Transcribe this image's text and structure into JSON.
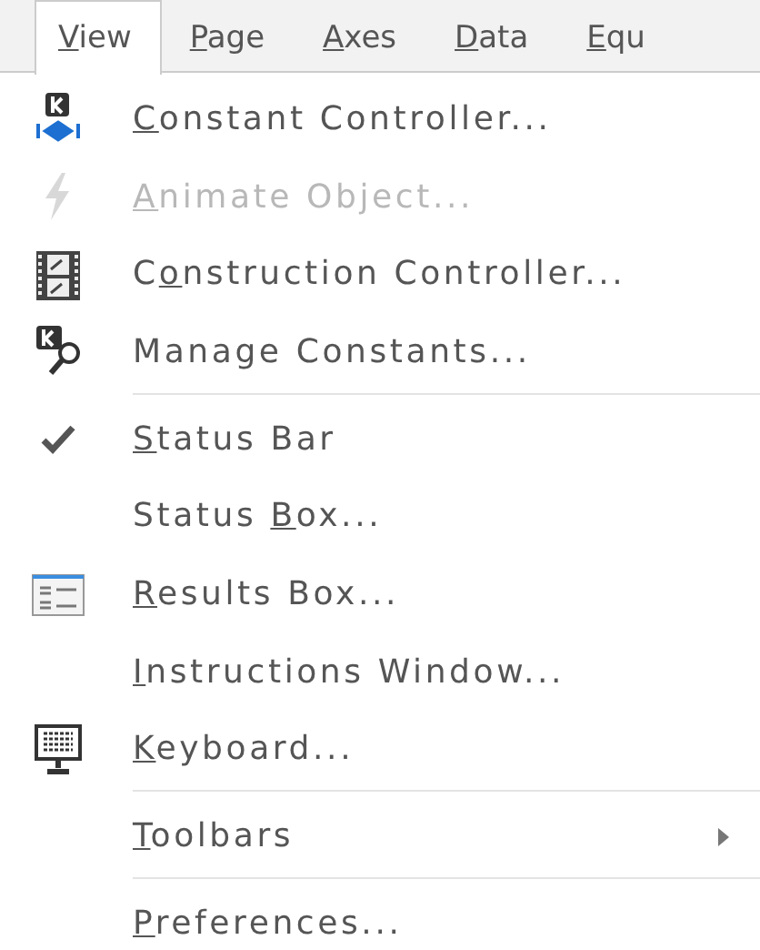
{
  "menu_bar": [
    {
      "key": "V",
      "post": "iew",
      "selected": true
    },
    {
      "key": "P",
      "post": "age",
      "selected": false
    },
    {
      "key": "A",
      "post": "xes",
      "selected": false
    },
    {
      "key": "D",
      "post": "ata",
      "selected": false
    },
    {
      "key": "E",
      "post": "qu",
      "selected": false
    }
  ],
  "menu": [
    {
      "kind": "item",
      "key": "C",
      "post": "onstant Controller...",
      "disabled": false,
      "checked": false
    },
    {
      "kind": "item",
      "key": "A",
      "post": "nimate Object...",
      "disabled": true,
      "checked": false
    },
    {
      "kind": "item",
      "pre": "C",
      "key": "o",
      "post": "nstruction Controller...",
      "disabled": false,
      "checked": false
    },
    {
      "kind": "item",
      "pre": "Manage Constants...",
      "disabled": false,
      "checked": false
    },
    {
      "kind": "separator"
    },
    {
      "kind": "item",
      "key": "S",
      "post": "tatus Bar",
      "disabled": false,
      "checked": true
    },
    {
      "kind": "item",
      "pre": "Status ",
      "key": "B",
      "post": "ox...",
      "disabled": false,
      "checked": false
    },
    {
      "kind": "item",
      "key": "R",
      "post": "esults Box...",
      "disabled": false,
      "checked": false
    },
    {
      "kind": "item",
      "key": "I",
      "post": "nstructions Window...",
      "disabled": false,
      "checked": false
    },
    {
      "kind": "item",
      "key": "K",
      "post": "eyboard...",
      "disabled": false,
      "checked": false
    },
    {
      "kind": "separator"
    },
    {
      "kind": "submenu",
      "key": "T",
      "post": "oolbars",
      "disabled": false,
      "checked": false
    },
    {
      "kind": "separator"
    },
    {
      "kind": "item",
      "key": "P",
      "post": "references...",
      "disabled": false,
      "checked": false
    }
  ]
}
